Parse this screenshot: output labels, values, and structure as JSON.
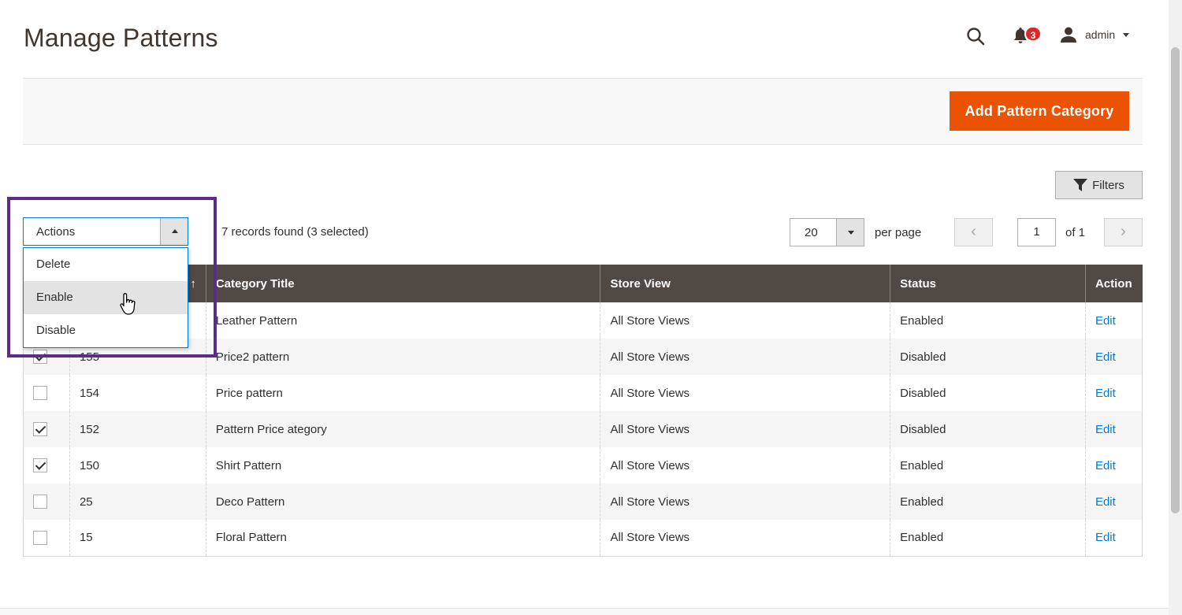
{
  "header": {
    "title": "Manage Patterns",
    "notification_count": "3",
    "user_name": "admin",
    "icons": [
      "search-icon",
      "bell-icon",
      "user-icon",
      "chevron-down-icon"
    ]
  },
  "toolbar": {
    "add_label": "Add Pattern Category",
    "filters_label": "Filters"
  },
  "mass_actions": {
    "label": "Actions",
    "options": [
      "Delete",
      "Enable",
      "Disable"
    ],
    "hovered": "Enable"
  },
  "records_text": "7 records found (3 selected)",
  "pager": {
    "per_page_value": "20",
    "per_page_label": "per page",
    "current_page": "1",
    "total_label": "of 1",
    "prev_symbol": "‹",
    "next_symbol": "›"
  },
  "grid": {
    "columns": [
      "",
      "",
      "Category Title",
      "Store View",
      "Status",
      "Action"
    ],
    "sort_symbol": "↑",
    "rows": [
      {
        "id": "",
        "title": "Leather Pattern",
        "store": "All Store Views",
        "status": "Enabled",
        "action": "Edit",
        "checked": false
      },
      {
        "id": "155",
        "title": "Price2 pattern",
        "store": "All Store Views",
        "status": "Disabled",
        "action": "Edit",
        "checked": true
      },
      {
        "id": "154",
        "title": "Price pattern",
        "store": "All Store Views",
        "status": "Disabled",
        "action": "Edit",
        "checked": false
      },
      {
        "id": "152",
        "title": "Pattern Price ategory",
        "store": "All Store Views",
        "status": "Disabled",
        "action": "Edit",
        "checked": true
      },
      {
        "id": "150",
        "title": "Shirt Pattern",
        "store": "All Store Views",
        "status": "Enabled",
        "action": "Edit",
        "checked": true
      },
      {
        "id": "25",
        "title": "Deco Pattern",
        "store": "All Store Views",
        "status": "Enabled",
        "action": "Edit",
        "checked": false
      },
      {
        "id": "15",
        "title": "Floral Pattern",
        "store": "All Store Views",
        "status": "Enabled",
        "action": "Edit",
        "checked": false
      }
    ]
  },
  "colors": {
    "accent": "#eb5202",
    "grid_header": "#514943",
    "link": "#007bdb",
    "highlight": "#5b2d8b",
    "badge": "#e22626"
  }
}
